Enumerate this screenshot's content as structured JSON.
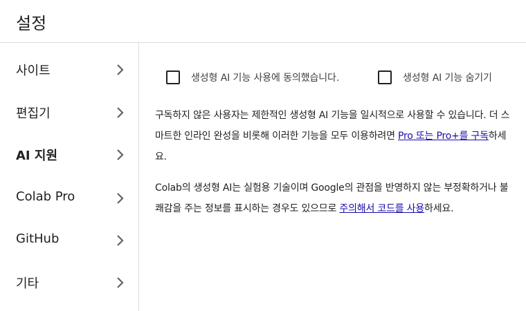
{
  "header": {
    "title": "설정"
  },
  "sidebar": {
    "items": [
      {
        "label": "사이트",
        "active": false
      },
      {
        "label": "편집기",
        "active": false
      },
      {
        "label": "AI 지원",
        "active": true
      },
      {
        "label": "Colab Pro",
        "active": false
      },
      {
        "label": "GitHub",
        "active": false
      },
      {
        "label": "기타",
        "active": false
      }
    ]
  },
  "content": {
    "checkboxes": [
      {
        "label": "생성형 AI 기능 사용에 동의했습니다.",
        "checked": false
      },
      {
        "label": "생성형 AI 기능 숨기기",
        "checked": false
      }
    ],
    "para1": {
      "text_before": "구독하지 않은 사용자는 제한적인 생성형 AI 기능을 일시적으로 사용할 수 있습니다. 더 스마트한 인라인 완성을 비롯해 이러한 기능을 모두 이용하려면 ",
      "link": "Pro 또는 Pro+를 구독",
      "text_after": "하세요."
    },
    "para2": {
      "text_before": "Colab의 생성형 AI는 실험용 기술이며 Google의 관점을 반영하지 않는 부정확하거나 불쾌감을 주는 정보를 표시하는 경우도 있으므로 ",
      "link": "주의해서 코드를 사용",
      "text_after": "하세요."
    }
  },
  "colors": {
    "link": "#1a0dab",
    "divider": "#dadce0",
    "text": "#202124"
  }
}
